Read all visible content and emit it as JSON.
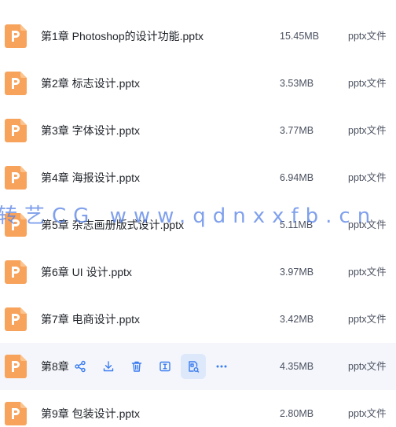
{
  "files": [
    {
      "name": "第1章 Photoshop的设计功能.pptx",
      "size": "15.45MB",
      "type": "pptx文件"
    },
    {
      "name": "第2章 标志设计.pptx",
      "size": "3.53MB",
      "type": "pptx文件"
    },
    {
      "name": "第3章 字体设计.pptx",
      "size": "3.77MB",
      "type": "pptx文件"
    },
    {
      "name": "第4章 海报设计.pptx",
      "size": "6.94MB",
      "type": "pptx文件"
    },
    {
      "name": "第5章 杂志画册版式设计.pptx",
      "size": "5.11MB",
      "type": "pptx文件"
    },
    {
      "name": "第6章 UI 设计.pptx",
      "size": "3.97MB",
      "type": "pptx文件"
    },
    {
      "name": "第7章 电商设计.pptx",
      "size": "3.42MB",
      "type": "pptx文件"
    },
    {
      "name": "第8章",
      "size": "4.35MB",
      "type": "pptx文件"
    },
    {
      "name": "第9章 包装设计.pptx",
      "size": "2.80MB",
      "type": "pptx文件"
    }
  ],
  "hover_actions": [
    "share-icon",
    "download-icon",
    "delete-icon",
    "rename-icon",
    "save-to-cloud-icon",
    "more-icon"
  ],
  "watermark": "转艺CG www.qdnxxfb.cn",
  "colors": {
    "icon_orange": "#f7a35c",
    "icon_orange_light": "#fbc48f",
    "action_blue": "#3b7cf0",
    "hover_row": "#f4f6fb",
    "active_action": "#dde8fb"
  }
}
